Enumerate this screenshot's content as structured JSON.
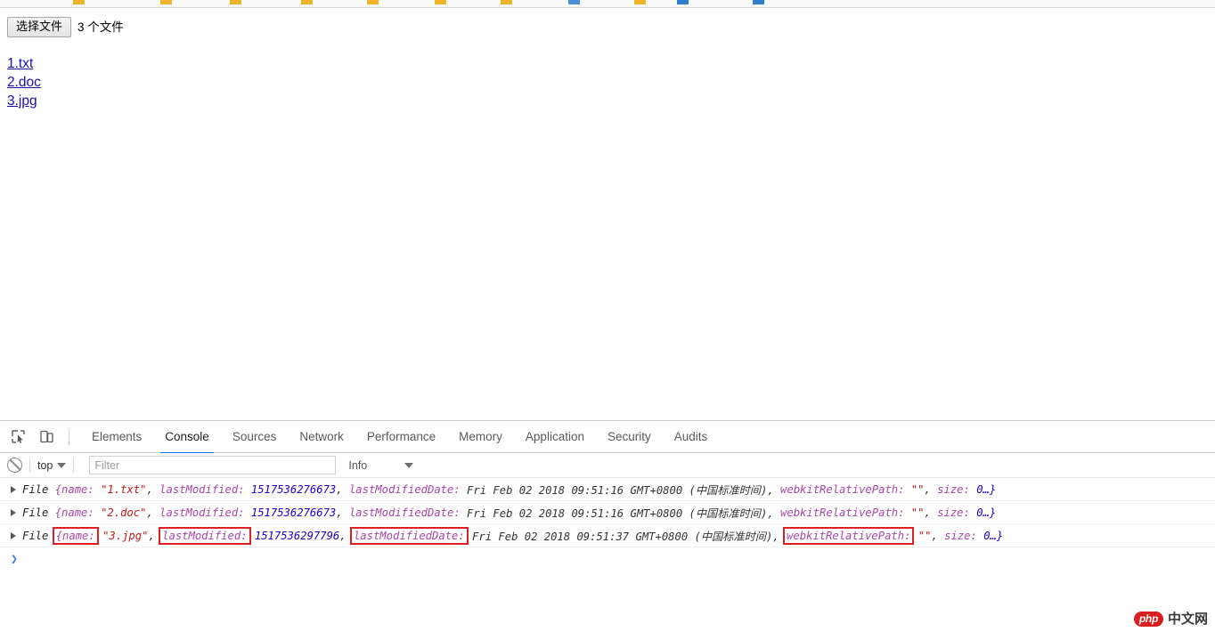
{
  "bookmarks": {
    "items": [
      {
        "icon": "folder-icon",
        "color": "#f0b429",
        "label": ""
      },
      {
        "icon": "folder-icon",
        "color": "#f0b429",
        "label": ""
      },
      {
        "icon": "folder-icon",
        "color": "#f0b429",
        "label": ""
      },
      {
        "icon": "folder-icon",
        "color": "#f0b429",
        "label": ""
      },
      {
        "icon": "folder-icon",
        "color": "#f0b429",
        "label": ""
      },
      {
        "icon": "folder-icon",
        "color": "#f0b429",
        "label": ""
      },
      {
        "icon": "folder-icon",
        "color": "#f0b429",
        "label": ""
      },
      {
        "icon": "bookmark-icon",
        "color": "#4a90d9",
        "label": ""
      },
      {
        "icon": "folder-icon",
        "color": "#f0b429",
        "label": ""
      },
      {
        "icon": "globe-icon",
        "color": "#2f80d0",
        "label": ""
      },
      {
        "icon": "bookmark-icon",
        "color": "#2f80d0",
        "label": ""
      }
    ]
  },
  "page": {
    "file_input": {
      "button_label": "选择文件",
      "status_text": "3 个文件"
    },
    "file_links": [
      {
        "label": "1.txt"
      },
      {
        "label": "2.doc"
      },
      {
        "label": "3.jpg"
      }
    ]
  },
  "devtools": {
    "tools": {
      "inspect_icon": "inspect-element-icon",
      "device_icon": "device-toolbar-icon"
    },
    "tabs": [
      {
        "label": "Elements",
        "active": false
      },
      {
        "label": "Console",
        "active": true
      },
      {
        "label": "Sources",
        "active": false
      },
      {
        "label": "Network",
        "active": false
      },
      {
        "label": "Performance",
        "active": false
      },
      {
        "label": "Memory",
        "active": false
      },
      {
        "label": "Application",
        "active": false
      },
      {
        "label": "Security",
        "active": false
      },
      {
        "label": "Audits",
        "active": false
      }
    ],
    "active_tab": "Console",
    "accent_color": "#1a73e8",
    "console_toolbar": {
      "clear_icon": "clear-console-icon",
      "context_label": "top",
      "filter_placeholder": "Filter",
      "filter_value": "",
      "level_label": "Info"
    },
    "console_logs": [
      {
        "expandable": true,
        "class_name": "File",
        "open_brace": "{name:",
        "name_value": "\"1.txt\"",
        "comma1": ",",
        "last_modified_key": "lastModified:",
        "last_modified_value": "1517536276673",
        "comma2": ",",
        "last_modified_date_key": "lastModifiedDate:",
        "last_modified_date_value": "Fri Feb 02 2018 09:51:16 GMT+0800 (中国标准时间),",
        "webkit_key": "webkitRelativePath:",
        "webkit_value": "\"\"",
        "comma3": ",",
        "size_key": "size:",
        "size_value": "0…}",
        "highlights": []
      },
      {
        "expandable": true,
        "class_name": "File",
        "open_brace": "{name:",
        "name_value": "\"2.doc\"",
        "comma1": ",",
        "last_modified_key": "lastModified:",
        "last_modified_value": "1517536276673",
        "comma2": ",",
        "last_modified_date_key": "lastModifiedDate:",
        "last_modified_date_value": "Fri Feb 02 2018 09:51:16 GMT+0800 (中国标准时间),",
        "webkit_key": "webkitRelativePath:",
        "webkit_value": "\"\"",
        "comma3": ",",
        "size_key": "size:",
        "size_value": "0…}",
        "highlights": []
      },
      {
        "expandable": true,
        "class_name": "File",
        "open_brace": "{name:",
        "name_value": "\"3.jpg\"",
        "comma1": ",",
        "last_modified_key": "lastModified:",
        "last_modified_value": "1517536297796",
        "comma2": ",",
        "last_modified_date_key": "lastModifiedDate:",
        "last_modified_date_value": "Fri Feb 02 2018 09:51:37 GMT+0800 (中国标准时间),",
        "webkit_key": "webkitRelativePath:",
        "webkit_value": "\"\"",
        "comma3": ",",
        "size_key": "size:",
        "size_value": "0…}",
        "highlights": [
          "open_brace",
          "last_modified_key",
          "last_modified_date_key",
          "webkit_key"
        ]
      }
    ],
    "prompt": {
      "caret": "❯"
    },
    "annotation_color": "#e02020"
  },
  "watermark": {
    "badge": "php",
    "text": "中文网"
  }
}
